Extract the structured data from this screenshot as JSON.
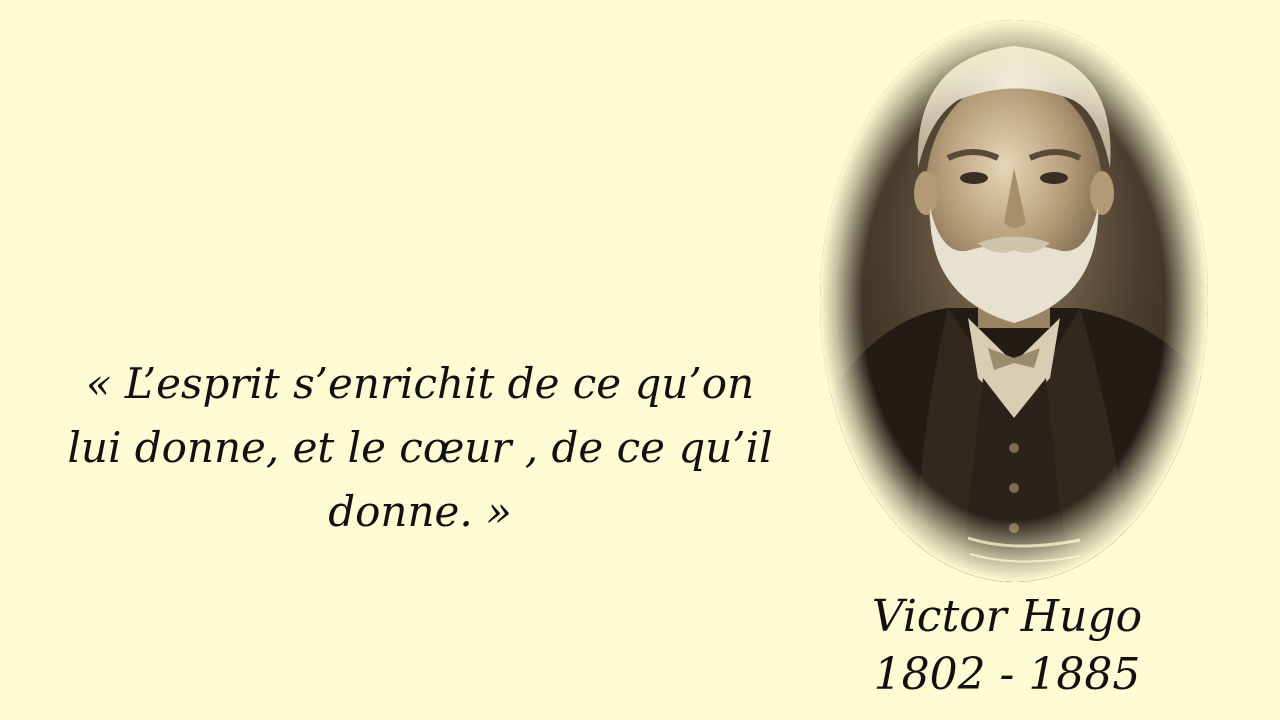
{
  "quote": {
    "line1": "« L’esprit s’enrichit de ce qu’on",
    "line2": "lui donne, et le cœur , de ce qu’il",
    "line3": "donne. »"
  },
  "author": {
    "name": "Victor Hugo",
    "dates": "1802 - 1885"
  },
  "portrait": {
    "subject": "Victor Hugo sepia portrait",
    "style": "oval vignette"
  },
  "colors": {
    "background": "#fdfbd3",
    "text": "#111111",
    "sepia_dark": "#2a2118",
    "sepia_mid": "#6b5a44",
    "sepia_light": "#d9cdb4"
  }
}
